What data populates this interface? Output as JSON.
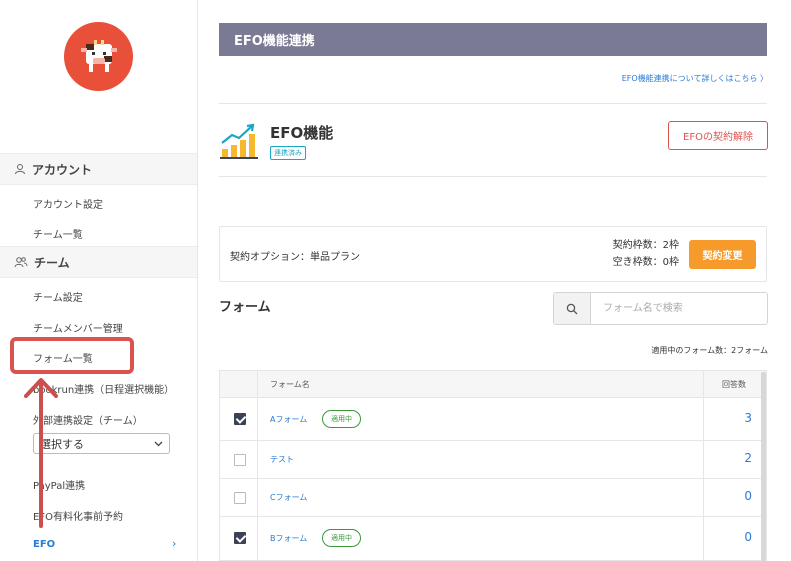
{
  "sidebar": {
    "account_section": "アカウント",
    "account_items": [
      "アカウント設定",
      "チーム一覧"
    ],
    "team_section": "チーム",
    "team_items": [
      "チーム設定",
      "チームメンバー管理",
      "フォーム一覧",
      "bookrun連携（日程選択機能）",
      "外部連携設定（チーム）"
    ],
    "select_value": "選択する",
    "bottom_items": [
      "PayPal連携",
      "EFO有料化事前予約"
    ],
    "active_item": "EFO"
  },
  "header": {
    "title": "EFO機能連携",
    "details_link": "EFO機能連携について詳しくはこちら"
  },
  "efo": {
    "title": "EFO機能",
    "status_badge": "連携済み",
    "cancel_button": "EFOの契約解除"
  },
  "contract": {
    "label": "契約オプション：単品プラン",
    "slots": "契約枠数：2枠",
    "free_slots": "空き枠数：0枠",
    "change_button": "契約変更"
  },
  "forms": {
    "heading": "フォーム",
    "search_placeholder": "フォーム名で検索",
    "applied_count": "適用中のフォーム数：2フォーム",
    "col_name": "フォーム名",
    "col_count": "回答数",
    "applied_badge": "適用中",
    "rows": [
      {
        "name": "Aフォーム",
        "applied": true,
        "checked": true,
        "count": "3"
      },
      {
        "name": "テスト",
        "applied": false,
        "checked": false,
        "count": "2"
      },
      {
        "name": "Cフォーム",
        "applied": false,
        "checked": false,
        "count": "0"
      },
      {
        "name": "Bフォーム",
        "applied": true,
        "checked": true,
        "count": "0"
      }
    ]
  },
  "colors": {
    "accent": "#2a7bd5",
    "header_bar": "#7b7a94",
    "danger": "#d9534f",
    "orange": "#f59a2b",
    "logo": "#e8503a"
  }
}
